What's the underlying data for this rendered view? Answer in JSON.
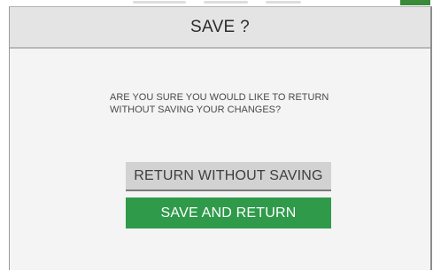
{
  "dialog": {
    "title": "SAVE ?",
    "message": "ARE YOU SURE YOU WOULD LIKE TO RETURN WITHOUT SAVING YOUR CHANGES?",
    "buttons": {
      "return_without_saving": "RETURN WITHOUT SAVING",
      "save_and_return": "SAVE AND RETURN"
    }
  },
  "colors": {
    "primary_button": "#2f9a4a",
    "secondary_button": "#d2d2d2",
    "header_background": "#e4e4e4"
  }
}
